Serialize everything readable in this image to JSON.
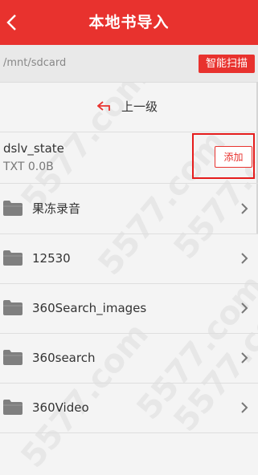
{
  "header": {
    "title": "本地书导入"
  },
  "path_bar": {
    "path": "/mnt/sdcard",
    "scan_label": "智能扫描"
  },
  "up_row": {
    "label": "上一级"
  },
  "file": {
    "name": "dslv_state",
    "meta": "TXT  0.0B",
    "add_label": "添加"
  },
  "folders": [
    {
      "label": "果冻录音"
    },
    {
      "label": "12530"
    },
    {
      "label": "360Search_images"
    },
    {
      "label": "360search"
    },
    {
      "label": "360Video"
    }
  ],
  "watermark": "5577.com",
  "colors": {
    "accent": "#e8322e",
    "highlight": "#e51c1c",
    "folder": "#7f7f7f"
  }
}
